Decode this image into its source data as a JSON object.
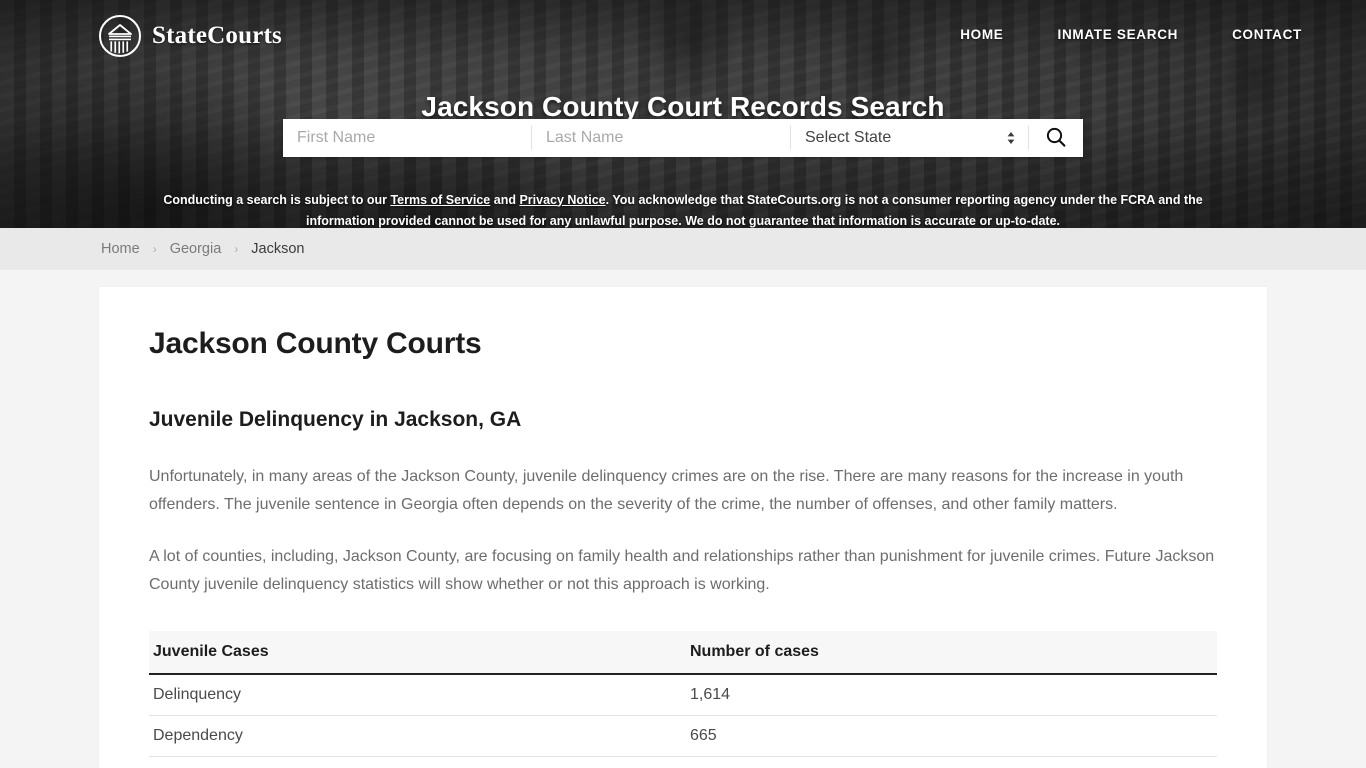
{
  "header": {
    "brand_name": "StateCourts",
    "logo_icon": "courthouse-circle-logo",
    "nav": [
      {
        "label": "HOME"
      },
      {
        "label": "INMATE SEARCH"
      },
      {
        "label": "CONTACT"
      }
    ]
  },
  "hero": {
    "title": "Jackson County Court Records Search",
    "search": {
      "first_name_placeholder": "First Name",
      "first_name_value": "",
      "last_name_placeholder": "Last Name",
      "last_name_value": "",
      "state_selected": "Select State",
      "state_options": [
        "Select State"
      ],
      "submit_icon": "search-icon"
    },
    "disclaimer": {
      "part1": "Conducting a search is subject to our ",
      "link1": "Terms of Service",
      "part2": " and ",
      "link2": "Privacy Notice",
      "part3": ". You acknowledge that StateCourts.org is not a consumer reporting agency under the FCRA and the information provided cannot be used for any unlawful purpose. We do not guarantee that information is accurate or up-to-date."
    }
  },
  "breadcrumb": {
    "items": [
      {
        "label": "Home"
      },
      {
        "label": "Georgia"
      },
      {
        "label": "Jackson"
      }
    ],
    "separator": "›"
  },
  "main": {
    "page_title": "Jackson County Courts",
    "section_heading": "Juvenile Delinquency in Jackson, GA",
    "paragraph_1": "Unfortunately, in many areas of the Jackson County, juvenile delinquency crimes are on the rise. There are many reasons for the increase in youth offenders. The juvenile sentence in Georgia often depends on the severity of the crime, the number of offenses, and other family matters.",
    "paragraph_2": "A lot of counties, including, Jackson County, are focusing on family health and relationships rather than punishment for juvenile crimes. Future Jackson County juvenile delinquency statistics will show whether or not this approach is working.",
    "table": {
      "headers": [
        "Juvenile Cases",
        "Number of cases"
      ],
      "rows": [
        {
          "case_type": "Delinquency",
          "count": "1,614"
        },
        {
          "case_type": "Dependency",
          "count": "665"
        }
      ]
    }
  },
  "colors": {
    "hero_overlay": "#2a2a2a",
    "breadcrumb_bg": "#e9e9e9",
    "page_bg": "#f4f4f4",
    "card_bg": "#ffffff",
    "body_text": "#6d6d6d",
    "heading_text": "#1d1d1d"
  }
}
